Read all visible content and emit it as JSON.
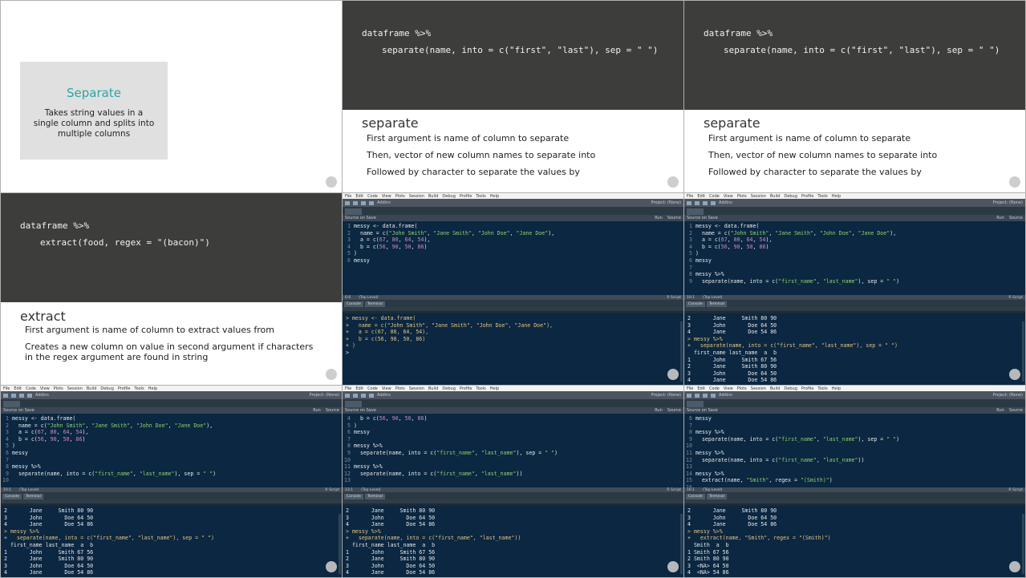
{
  "slide_intro": {
    "title": "Separate",
    "text": "Takes string values in a single column and splits into multiple columns"
  },
  "slide_separate": {
    "code1": "dataframe %>%",
    "code2": "separate(name, into = c(\"first\", \"last\"), sep = \" \")",
    "title": "separate",
    "bullets": [
      "First argument is name of column to separate",
      "Then, vector of new column names to separate into",
      "Followed by character to separate the values by"
    ]
  },
  "slide_extract": {
    "code1": "dataframe %>%",
    "code2": "extract(food, regex = \"(bacon)\")",
    "title": "extract",
    "bullets": [
      "First argument is name of column to extract values from",
      "Creates a new column on value in second argument if characters in the regex argument are found in string"
    ]
  },
  "rstudio": {
    "menu": [
      "File",
      "Edit",
      "Code",
      "View",
      "Plots",
      "Session",
      "Build",
      "Debug",
      "Profile",
      "Tools",
      "Help"
    ],
    "addins": "Addins",
    "project": "Project: (None)",
    "source_on_save": "Source on Save",
    "run": "Run",
    "source": "Source",
    "scope": "(Top Level)",
    "filetype": "R Script",
    "console_tab": "Console",
    "terminal_tab": "Terminal"
  },
  "panels": [
    {
      "editor": [
        [
          "1",
          "messy <- data.frame("
        ],
        [
          "2",
          "  name = c(\"John Smith\", \"Jane Smith\", \"John Doe\", \"Jane Doe\"),"
        ],
        [
          "3",
          "  a = c(67, 80, 64, 54),"
        ],
        [
          "4",
          "  b = c(56, 90, 50, 86)"
        ],
        [
          "5",
          ")"
        ],
        [
          "6",
          "messy"
        ]
      ],
      "console": [
        "> messy <- data.frame(",
        "+   name = c(\"John Smith\", \"Jane Smith\", \"John Doe\", \"Jane Doe\"),",
        "+   a = c(67, 80, 64, 54),",
        "+   b = c(56, 90, 50, 86)",
        "+ )",
        "> "
      ],
      "pos": "6:6"
    },
    {
      "editor": [
        [
          "1",
          "messy <- data.frame("
        ],
        [
          "2",
          "  name = c(\"John Smith\", \"Jane Smith\", \"John Doe\", \"Jane Doe\"),"
        ],
        [
          "3",
          "  a = c(67, 80, 64, 54),"
        ],
        [
          "4",
          "  b = c(56, 90, 50, 86)"
        ],
        [
          "5",
          ")"
        ],
        [
          "6",
          "messy"
        ],
        [
          "7",
          ""
        ],
        [
          "8",
          "messy %>%"
        ],
        [
          "9",
          "  separate(name, into = c(\"first_name\", \"last_name\"), sep = \" \")"
        ]
      ],
      "console": [
        "2       Jane     Smith 80 90",
        "3       John       Doe 64 50",
        "4       Jane       Doe 54 86",
        "> messy %>%",
        "+   separate(name, into = c(\"first_name\", \"last_name\"), sep = \" \")",
        "  first_name last_name  a  b",
        "1       John     Smith 67 56",
        "2       Jane     Smith 80 90",
        "3       John       Doe 64 50",
        "4       Jane       Doe 54 86",
        "> "
      ],
      "pos": "10:1"
    },
    {
      "editor": [
        [
          "1",
          "messy <- data.frame("
        ],
        [
          "2",
          "  name = c(\"John Smith\", \"Jane Smith\", \"John Doe\", \"Jane Doe\"),"
        ],
        [
          "3",
          "  a = c(67, 80, 64, 54),"
        ],
        [
          "4",
          "  b = c(56, 90, 50, 86)"
        ],
        [
          "5",
          ")"
        ],
        [
          "6",
          "messy"
        ],
        [
          "7",
          ""
        ],
        [
          "8",
          "messy %>%"
        ],
        [
          "9",
          "  separate(name, into = c(\"first_name\", \"last_name\"), sep = \" \")"
        ],
        [
          "10",
          ""
        ]
      ],
      "console": [
        "2       Jane     Smith 80 90",
        "3       John       Doe 64 50",
        "4       Jane       Doe 54 86",
        "> messy %>%",
        "+   separate(name, into = c(\"first_name\", \"last_name\"), sep = \" \")",
        "  first_name last_name  a  b",
        "1       John     Smith 67 56",
        "2       Jane     Smith 80 90",
        "3       John       Doe 64 50",
        "4       Jane       Doe 54 86",
        "> "
      ],
      "pos": "10:1"
    },
    {
      "editor": [
        [
          "4",
          "  b = c(56, 90, 50, 86)"
        ],
        [
          "5",
          ")"
        ],
        [
          "6",
          "messy"
        ],
        [
          "7",
          ""
        ],
        [
          "8",
          "messy %>%"
        ],
        [
          "9",
          "  separate(name, into = c(\"first_name\", \"last_name\"), sep = \" \")"
        ],
        [
          "10",
          ""
        ],
        [
          "11",
          "messy %>%"
        ],
        [
          "12",
          "  separate(name, into = c(\"first_name\", \"last_name\"))"
        ],
        [
          "13",
          ""
        ]
      ],
      "console": [
        "2       Jane     Smith 80 90",
        "3       John       Doe 64 50",
        "4       Jane       Doe 54 86",
        "> messy %>%",
        "+   separate(name, into = c(\"first_name\", \"last_name\"))",
        "  first_name last_name  a  b",
        "1       John     Smith 67 56",
        "2       Jane     Smith 80 90",
        "3       John       Doe 64 50",
        "4       Jane       Doe 54 86",
        "> "
      ],
      "pos": "13:1"
    },
    {
      "editor": [
        [
          "6",
          "messy"
        ],
        [
          "7",
          ""
        ],
        [
          "8",
          "messy %>%"
        ],
        [
          "9",
          "  separate(name, into = c(\"first_name\", \"last_name\"), sep = \" \")"
        ],
        [
          "10",
          ""
        ],
        [
          "11",
          "messy %>%"
        ],
        [
          "12",
          "  separate(name, into = c(\"first_name\", \"last_name\"))"
        ],
        [
          "13",
          ""
        ],
        [
          "14",
          "messy %>%"
        ],
        [
          "15",
          "  extract(name, \"Smith\", regex = \"(Smith)\")"
        ],
        [
          "16",
          ""
        ]
      ],
      "console": [
        "2       Jane     Smith 80 90",
        "3       John       Doe 64 50",
        "4       Jane       Doe 54 86",
        "> messy %>%",
        "+   extract(name, \"Smith\", regex = \"(Smith)\")",
        "  Smith  a  b",
        "1 Smith 67 56",
        "2 Smith 80 90",
        "3  <NA> 64 50",
        "4  <NA> 54 86",
        "> "
      ],
      "pos": "16:1"
    }
  ]
}
